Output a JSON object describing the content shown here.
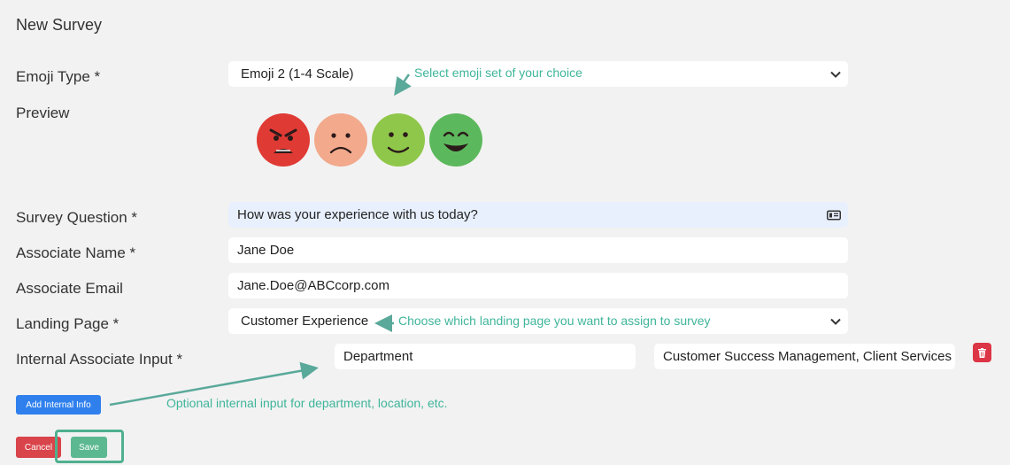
{
  "page": {
    "title": "New Survey"
  },
  "labels": {
    "emoji_type": "Emoji Type *",
    "preview": "Preview",
    "survey_question": "Survey Question *",
    "associate_name": "Associate Name *",
    "associate_email": "Associate Email",
    "landing_page": "Landing Page *",
    "internal_input": "Internal Associate Input *"
  },
  "fields": {
    "emoji_type": "Emoji 2 (1-4 Scale)",
    "survey_question": "How was your experience with us today?",
    "associate_name": "Jane Doe",
    "associate_email": "Jane.Doe@ABCcorp.com",
    "landing_page": "Customer Experience",
    "internal_key": "Department",
    "internal_value": "Customer Success Management, Client Services"
  },
  "hints": {
    "emoji": "Select emoji set of your choice",
    "landing": "Choose which landing page you want to assign to survey",
    "internal": "Optional internal input for department, location, etc."
  },
  "preview_emojis": [
    {
      "icon": "angry-face-icon",
      "color": "#e03a34"
    },
    {
      "icon": "sad-face-icon",
      "color": "#f2a98c"
    },
    {
      "icon": "smiling-face-icon",
      "color": "#8fc74a"
    },
    {
      "icon": "happy-face-icon",
      "color": "#5cb85c"
    }
  ],
  "buttons": {
    "add_internal_info": "Add Internal Info",
    "cancel": "Cancel",
    "save": "Save"
  },
  "colors": {
    "primary": "#2f80ed",
    "danger": "#d9434a",
    "success": "#5cb891",
    "annotation": "#3fb59a"
  }
}
